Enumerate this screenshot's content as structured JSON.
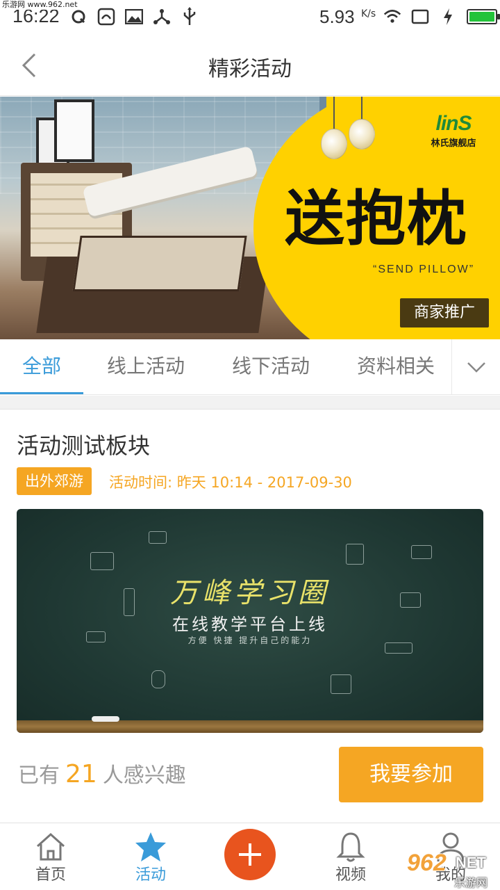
{
  "watermark": {
    "top_left": "乐游网 www.962.net",
    "bottom_right_logo": "962",
    "bottom_right_net": "NET",
    "bottom_right_site": "乐游网"
  },
  "status_bar": {
    "time": "16:22",
    "speed": "5.93",
    "speed_unit": "K/s",
    "battery_level": 1.0
  },
  "nav": {
    "title": "精彩活动",
    "back_icon": "chevron-left-icon"
  },
  "banner": {
    "brand_mark": "linS",
    "brand_name": "林氏旗舰店",
    "headline": "送抱枕",
    "subline": "“SEND PILLOW”",
    "badge": "商家推广",
    "accent_color": "#ffd100"
  },
  "tabs": {
    "items": [
      {
        "label": "全部",
        "active": true
      },
      {
        "label": "线上活动",
        "active": false
      },
      {
        "label": "线下活动",
        "active": false
      },
      {
        "label": "资料相关",
        "active": false
      }
    ],
    "more_icon": "chevron-down-icon",
    "active_color": "#3a9bd9"
  },
  "card": {
    "title": "活动测试板块",
    "tag": "出外郊游",
    "time_label": "活动时间: 昨天 10:14 - 2017-09-30",
    "image": {
      "title": "万峰学习圈",
      "subtitle": "在线教学平台上线",
      "tagline": "方便  快捷  提升自己的能力"
    },
    "interest_prefix": "已有",
    "interest_count": "21",
    "interest_suffix": "人感兴趣",
    "join_label": "我要参加",
    "accent_color": "#f5a623"
  },
  "bottom_bar": {
    "items": [
      {
        "label": "首页",
        "icon": "home-icon",
        "active": false
      },
      {
        "label": "活动",
        "icon": "star-icon",
        "active": true
      },
      {
        "label": "视频",
        "icon": "bell-icon",
        "active": false
      },
      {
        "label": "我的",
        "icon": "user-icon",
        "active": false
      }
    ],
    "add_icon": "plus-icon",
    "add_color": "#e8541e"
  }
}
